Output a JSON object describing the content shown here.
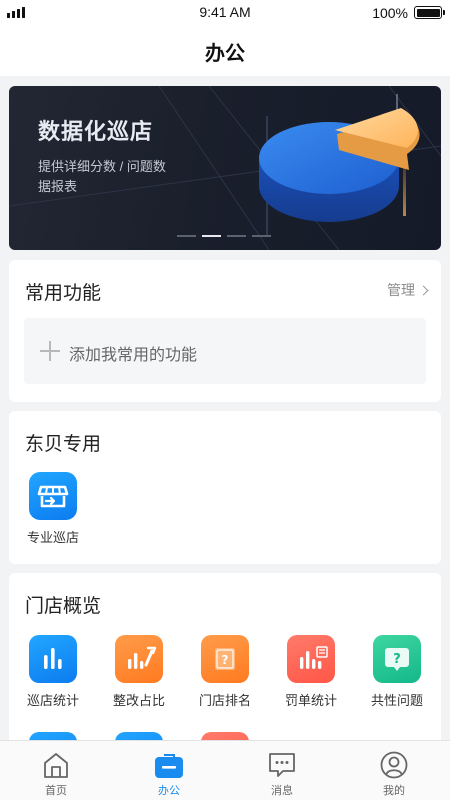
{
  "status_bar": {
    "time": "9:41 AM",
    "battery": "100%"
  },
  "nav": {
    "title": "办公"
  },
  "banner": {
    "title": "数据化巡店",
    "subtitle": "提供详细分数 / 问题数据报表",
    "page_count": 4,
    "active_index": 1
  },
  "common_functions": {
    "title": "常用功能",
    "manage_label": "管理",
    "add_label": "添加我常用的功能"
  },
  "dongbei": {
    "title": "东贝专用",
    "items": [
      {
        "label": "专业巡店",
        "icon": "store-icon"
      }
    ]
  },
  "store_overview": {
    "title": "门店概览",
    "items": [
      {
        "label": "巡店统计",
        "icon": "bar-chart-icon"
      },
      {
        "label": "整改占比",
        "icon": "wrench-chart-icon"
      },
      {
        "label": "门店排名",
        "icon": "ranking-icon"
      },
      {
        "label": "罚单统计",
        "icon": "penalty-chart-icon"
      },
      {
        "label": "共性问题",
        "icon": "question-icon"
      }
    ]
  },
  "tab_bar": {
    "tabs": [
      {
        "label": "首页",
        "icon": "home-icon"
      },
      {
        "label": "办公",
        "icon": "briefcase-icon",
        "active": true
      },
      {
        "label": "消息",
        "icon": "message-icon"
      },
      {
        "label": "我的",
        "icon": "profile-icon"
      }
    ]
  },
  "colors": {
    "accent": "#1a8cf0",
    "banner_bg": "#1a1f2c"
  }
}
